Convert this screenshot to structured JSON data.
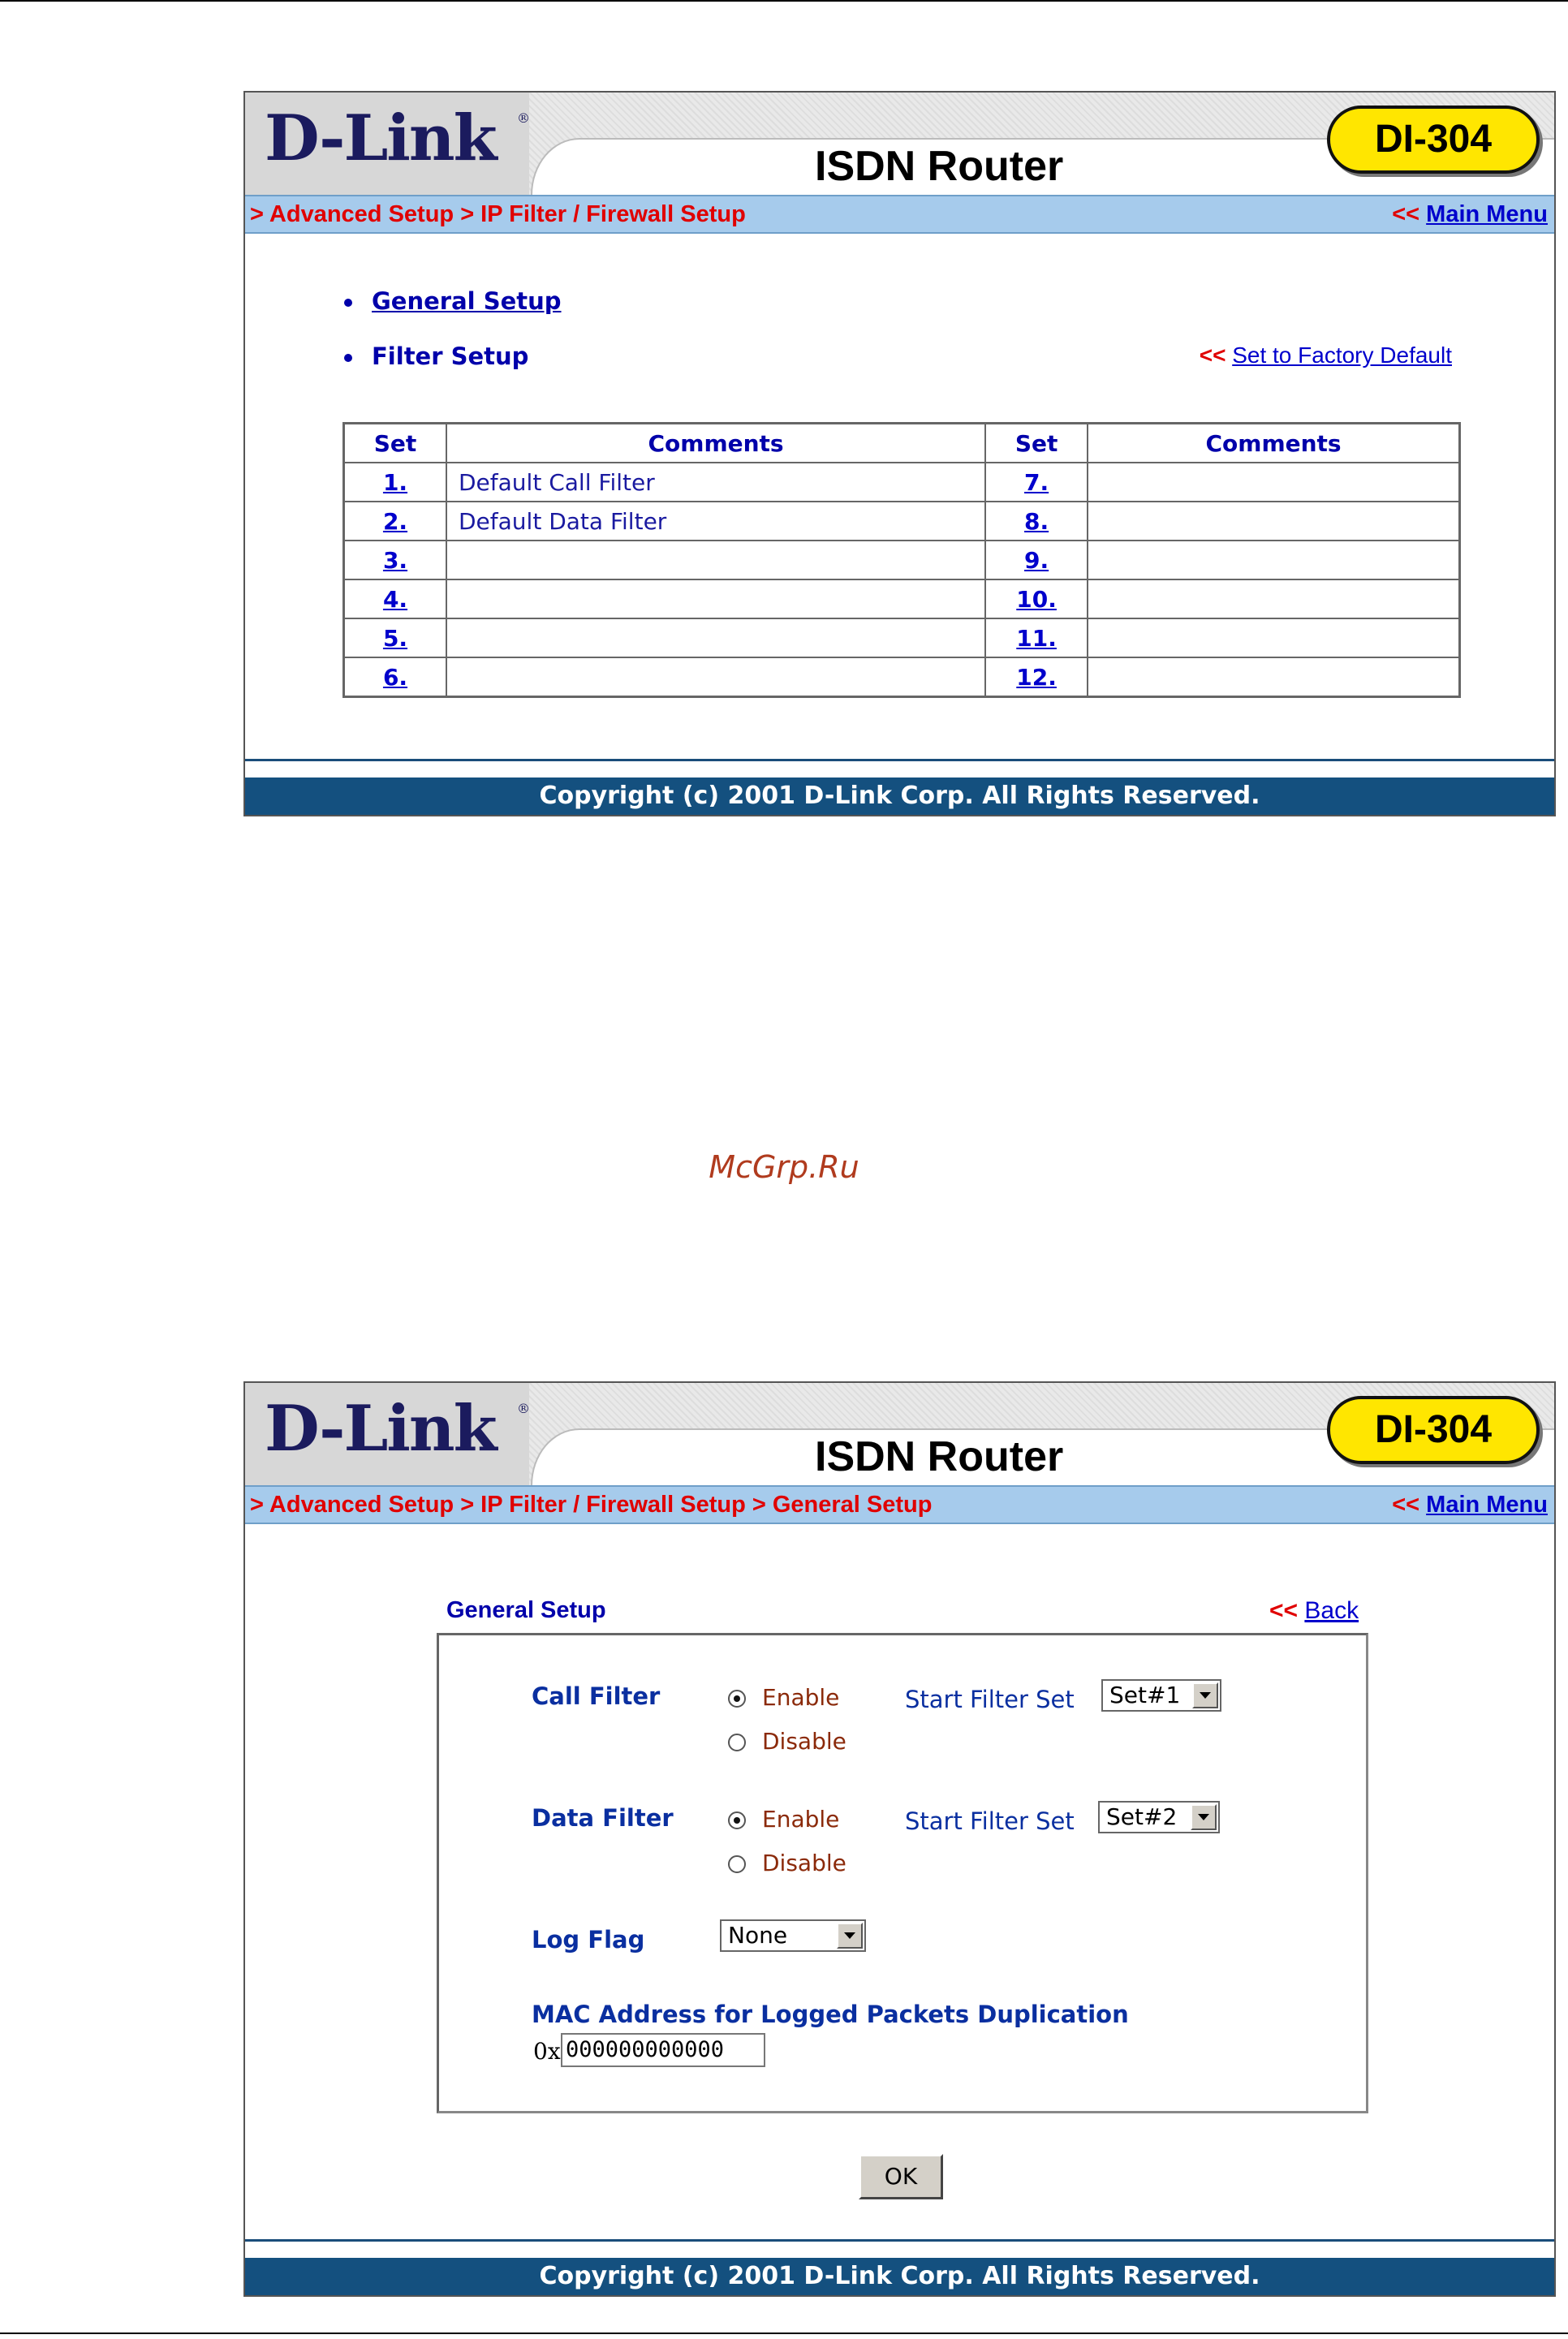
{
  "brand": {
    "logo": "D-Link",
    "logo_mark": "®",
    "product": "ISDN Router",
    "model": "DI-304"
  },
  "nav": {
    "main_menu_prefix": "<<",
    "main_menu": "Main Menu"
  },
  "screen1": {
    "breadcrumb": "> Advanced Setup > IP Filter / Firewall Setup",
    "general_setup_link": "General Setup",
    "filter_setup_label": "Filter Setup",
    "factory_prefix": "<<",
    "factory_default": "Set to Factory Default",
    "table": {
      "headers": [
        "Set",
        "Comments",
        "Set",
        "Comments"
      ],
      "rows": [
        {
          "set_a": "1.",
          "comment_a": "Default Call Filter",
          "set_b": "7.",
          "comment_b": ""
        },
        {
          "set_a": "2.",
          "comment_a": "Default Data Filter",
          "set_b": "8.",
          "comment_b": ""
        },
        {
          "set_a": "3.",
          "comment_a": "",
          "set_b": "9.",
          "comment_b": ""
        },
        {
          "set_a": "4.",
          "comment_a": "",
          "set_b": "10.",
          "comment_b": ""
        },
        {
          "set_a": "5.",
          "comment_a": "",
          "set_b": "11.",
          "comment_b": ""
        },
        {
          "set_a": "6.",
          "comment_a": "",
          "set_b": "12.",
          "comment_b": ""
        }
      ]
    }
  },
  "footer": {
    "copyright": "Copyright (c) 2001 D-Link Corp. All Rights Reserved."
  },
  "watermark": "McGrp.Ru",
  "screen2": {
    "breadcrumb": "> Advanced Setup > IP Filter / Firewall Setup > General Setup",
    "section_title": "General Setup",
    "back_prefix": "<<",
    "back": "Back",
    "call_filter": {
      "label": "Call Filter",
      "enable": "Enable",
      "disable": "Disable",
      "selected": "Enable",
      "start_filter_label": "Start Filter Set",
      "start_filter_value": "Set#1"
    },
    "data_filter": {
      "label": "Data Filter",
      "enable": "Enable",
      "disable": "Disable",
      "selected": "Enable",
      "start_filter_label": "Start Filter Set",
      "start_filter_value": "Set#2"
    },
    "log_flag": {
      "label": "Log Flag",
      "value": "None"
    },
    "mac": {
      "label": "MAC Address for Logged Packets Duplication",
      "prefix": "0x",
      "value": "000000000000"
    },
    "ok_label": "OK"
  }
}
